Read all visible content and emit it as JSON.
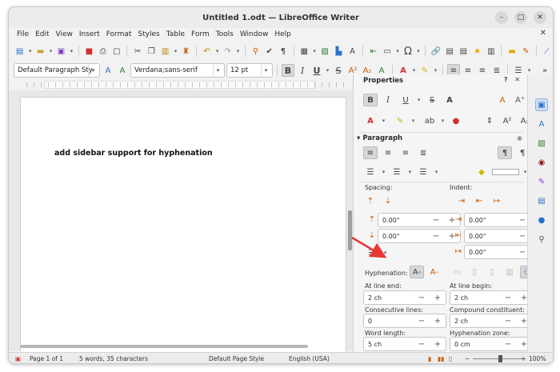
{
  "window": {
    "title": "Untitled 1.odt — LibreOffice Writer"
  },
  "menu": [
    "File",
    "Edit",
    "View",
    "Insert",
    "Format",
    "Styles",
    "Table",
    "Form",
    "Tools",
    "Window",
    "Help"
  ],
  "formatting": {
    "paragraph_style": "Default Paragraph Sty",
    "font_name": "Verdana;sans-serif",
    "font_size": "12 pt"
  },
  "document": {
    "body_text": "add sidebar support for hyphenation"
  },
  "sidebar": {
    "title": "Properties",
    "paragraph_section": "Paragraph",
    "spacing_label": "Spacing:",
    "indent_label": "Indent:",
    "spacing_above": "0.00\"",
    "spacing_below": "0.00\"",
    "indent_before": "0.00\"",
    "indent_after": "0.00\"",
    "indent_first": "0.00\"",
    "hyphenation_label": "Hyphenation:",
    "at_line_end_label": "At line end:",
    "at_line_end": "2 ch",
    "at_line_begin_label": "At line begin:",
    "at_line_begin": "2 ch",
    "consecutive_lines_label": "Consecutive lines:",
    "consecutive_lines": "0",
    "compound_constituent_label": "Compound constituent:",
    "compound_constituent": "2 ch",
    "word_length_label": "Word length:",
    "word_length": "5 ch",
    "hyphenation_zone_label": "Hyphenation zone:",
    "hyphenation_zone": "0 cm"
  },
  "status": {
    "page": "Page 1 of 1",
    "words": "5 words, 35 characters",
    "page_style": "Default Page Style",
    "language": "English (USA)",
    "zoom": "100%"
  },
  "colors": {
    "annotation_arrow": "#e53935",
    "hyphenation_active": "#d7d7d7"
  }
}
